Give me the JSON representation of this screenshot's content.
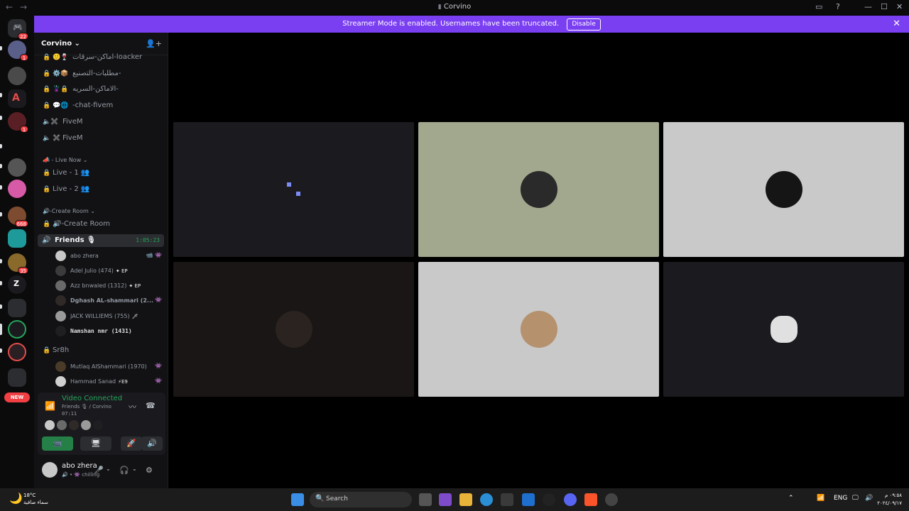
{
  "window": {
    "title": "Corvino",
    "back": "←",
    "forward": "→",
    "controls": {
      "inbox": "▭",
      "help": "?",
      "minimize": "—",
      "maximize": "☐",
      "close": "✕"
    }
  },
  "banner": {
    "text": "Streamer Mode is enabled. Usernames have been truncated.",
    "action": "Disable",
    "close": "✕"
  },
  "servers": {
    "home_badge": "22",
    "badges": [
      "1",
      "1",
      "668",
      "35"
    ],
    "new_label": "NEW"
  },
  "guild": {
    "name": "Corvino ⌄",
    "invite_icon": "👤+"
  },
  "channels": [
    {
      "name": "اماكن-سرقات-loacker",
      "icon": "🙂🍷",
      "locked": true
    },
    {
      "name": "مطلبات-التصنيع-",
      "icon": "⚙️📦",
      "locked": true
    },
    {
      "name": "الاماكن-السريه-",
      "icon": "🦹🔒",
      "locked": true
    },
    {
      "name": "-chat-fivem",
      "icon": "💬🌐",
      "locked": true
    },
    {
      "name": "FiveM",
      "icon": "🔈✖️",
      "locked": false
    },
    {
      "name": "FiveM",
      "icon": "✖️",
      "locked": true
    }
  ],
  "categories": {
    "live_now": "📣 - Live Now ⌄",
    "create_room": "🔊-Create Room ⌄"
  },
  "live_channels": [
    {
      "name": "Live - 1 👥"
    },
    {
      "name": "Live - 2 👥"
    }
  ],
  "create_room_channel": "🔊-Create Room",
  "active_channel": {
    "name": "Friends 🎙",
    "timer": "1:05:23"
  },
  "voice_users": [
    {
      "name": "abo zhera",
      "badge": "",
      "right": "📹 👾"
    },
    {
      "name": "Adel Julio (474)",
      "badge": "✦ EP",
      "right": ""
    },
    {
      "name": "Azz bnwaled (1312)",
      "badge": "✦ EP",
      "right": ""
    },
    {
      "name": "Dghash AL-shammari (2...",
      "badge": "",
      "right": "👾"
    },
    {
      "name": "JACK WILLIEMS (755)",
      "badge": "🗡",
      "right": ""
    },
    {
      "name": "Namshan nmr (1431)",
      "badge": "",
      "right": ""
    }
  ],
  "sr8h": {
    "name": "Sr8h",
    "users": [
      {
        "name": "Mutlaq AlShammari (1970)",
        "badge": "",
        "right": "👾"
      },
      {
        "name": "Hammad Sanad",
        "badge": "⚡E9",
        "right": "👾"
      }
    ]
  },
  "voice_panel": {
    "status": "Video Connected",
    "sub": "Friends 🎙 / Corvino",
    "time": "07:11",
    "signal_icon": "📶",
    "noise_icon": "〰",
    "disconnect_icon": "☎",
    "buttons": {
      "camera": "📹",
      "screen": "🖥",
      "activity": "🚀",
      "soundboard": "🔊"
    }
  },
  "user": {
    "name": "abo zhera",
    "status": "🔊 • 👾 chilling",
    "mic_icon": "🎤",
    "headphones_icon": "🎧",
    "settings_icon": "⚙",
    "chevron": "⌄"
  },
  "taskbar": {
    "temp": "18°C",
    "weather": "سماء صافية",
    "search_icon": "🔍",
    "search": "Search",
    "lang": "ENG",
    "tray": {
      "up": "⌃",
      "wifi": "📶",
      "volume": "🔊",
      "display": "🖵"
    },
    "time": "٠٩:٥٨ م",
    "date": "٢٠٢٤/٠٩/١٧"
  },
  "colors": {
    "banner": "#7b3ff2",
    "connected": "#23a55a",
    "background": "#000000",
    "sidebar": "#121214"
  }
}
